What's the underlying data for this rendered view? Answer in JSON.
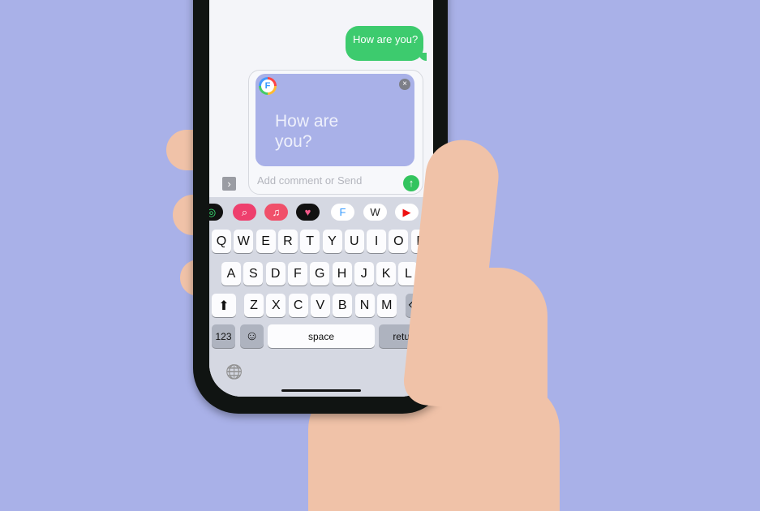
{
  "conversation": {
    "sent_message": "How are you?"
  },
  "compose": {
    "card_text": "How are you?",
    "app_badge": "F",
    "comment_placeholder": "Add comment or Send",
    "close": "×",
    "send": "↑",
    "expand": "›"
  },
  "app_strip": [
    {
      "name": "activity",
      "glyph": "◎",
      "bg": "#111111",
      "fg": "#3cf07a"
    },
    {
      "name": "image-search",
      "glyph": "⌕",
      "bg": "#ee3f6d",
      "fg": "#ffffff"
    },
    {
      "name": "music",
      "glyph": "♫",
      "bg": "#f0506a",
      "fg": "#ffffff"
    },
    {
      "name": "digital-touch",
      "glyph": "♥",
      "bg": "#111111",
      "fg": "#f45a8a"
    },
    {
      "name": "f-app",
      "glyph": "F",
      "bg": "#ffffff",
      "fg": "#3399ff"
    },
    {
      "name": "wikipedia",
      "glyph": "W",
      "bg": "#ffffff",
      "fg": "#222222"
    },
    {
      "name": "youtube",
      "glyph": "▶",
      "bg": "#ffffff",
      "fg": "#ee1111"
    }
  ],
  "keyboard": {
    "row1": [
      "Q",
      "W",
      "E",
      "R",
      "T",
      "Y",
      "U",
      "I",
      "O",
      "P"
    ],
    "row2": [
      "A",
      "S",
      "D",
      "F",
      "G",
      "H",
      "J",
      "K",
      "L"
    ],
    "row3": [
      "Z",
      "X",
      "C",
      "V",
      "B",
      "N",
      "M"
    ],
    "shift": "⬆",
    "delete": "⌫",
    "numbers": "123",
    "emoji": "☺",
    "space": "space",
    "return": "return",
    "globe": "🌐"
  },
  "colors": {
    "background": "#a9b1e8",
    "bubble": "#3dcb6e",
    "send": "#33c45e"
  }
}
